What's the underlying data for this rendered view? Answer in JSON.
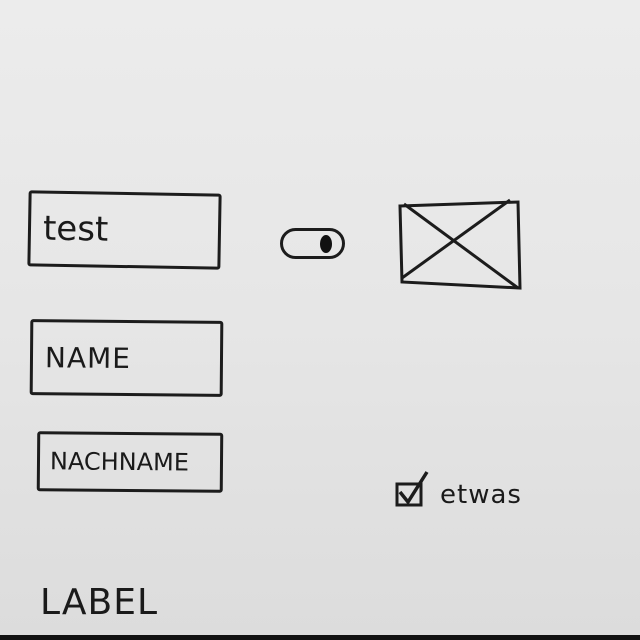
{
  "form": {
    "fields": [
      {
        "value": "test"
      },
      {
        "value": "NAME"
      },
      {
        "value": "NACHNAME"
      }
    ],
    "toggle": {
      "state": "on"
    },
    "image_placeholder": {
      "icon": "image-placeholder-x"
    },
    "checkbox": {
      "checked": true,
      "label": "etwas"
    },
    "label": "LABEL"
  }
}
